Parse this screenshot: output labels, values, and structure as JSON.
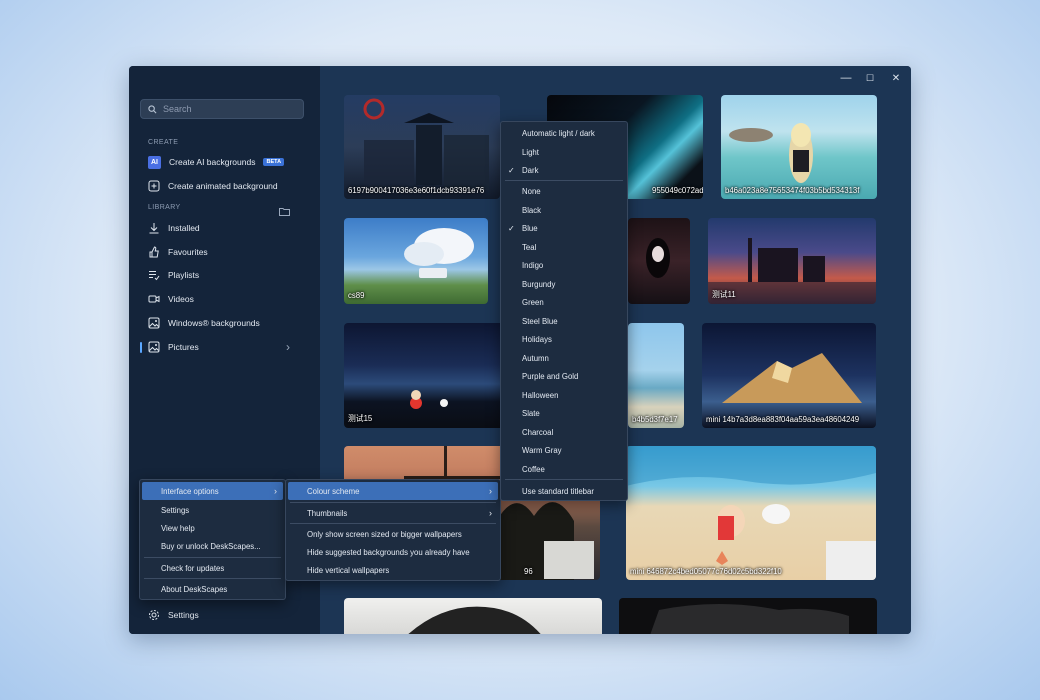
{
  "window": {
    "minimize": "—",
    "maximize": "☐",
    "close": "✕"
  },
  "search": {
    "placeholder": "Search"
  },
  "sidebar": {
    "create_label": "CREATE",
    "library_label": "LIBRARY",
    "ai_badge": "AI",
    "beta": "BETA",
    "items": [
      {
        "label": "Create AI backgrounds",
        "icon": "ai-icon"
      },
      {
        "label": "Create animated background",
        "icon": "add-icon"
      },
      {
        "label": "Installed",
        "icon": "download-icon"
      },
      {
        "label": "Favourites",
        "icon": "thumb-icon"
      },
      {
        "label": "Playlists",
        "icon": "playlist-icon"
      },
      {
        "label": "Videos",
        "icon": "video-icon"
      },
      {
        "label": "Windows® backgrounds",
        "icon": "image-icon"
      },
      {
        "label": "Pictures",
        "icon": "image-icon"
      }
    ],
    "settings": "Settings"
  },
  "tiles": [
    {
      "caption": "6197b900417036e3e60f1dcb93391e76"
    },
    {
      "caption": "955049c072ad9e6"
    },
    {
      "caption": "b46a023a8e75653474f03b5bd534313f"
    },
    {
      "caption": "cs89"
    },
    {
      "caption": ""
    },
    {
      "caption": "测试11"
    },
    {
      "caption": "测试15"
    },
    {
      "caption": "b4b5d3f7e17"
    },
    {
      "caption": "mini 14b7a3d8ea883f04aa59a3ea48604249"
    },
    {
      "caption": "96"
    },
    {
      "caption": "mini 646872c4bed05077c76d02c5bd322f10"
    }
  ],
  "main_menu": [
    {
      "label": "Interface options"
    },
    {
      "label": "Settings"
    },
    {
      "label": "View help"
    },
    {
      "label": "Buy or unlock DeskScapes..."
    },
    {
      "label": "Check for updates"
    },
    {
      "label": "About DeskScapes"
    }
  ],
  "interface_menu": [
    {
      "label": "Colour scheme"
    },
    {
      "label": "Thumbnails"
    },
    {
      "label": "Only show screen sized or bigger wallpapers"
    },
    {
      "label": "Hide suggested backgrounds you already have"
    },
    {
      "label": "Hide vertical wallpapers"
    }
  ],
  "colour_menu": [
    {
      "label": "Automatic light / dark",
      "checked": false
    },
    {
      "label": "Light",
      "checked": false
    },
    {
      "label": "Dark",
      "checked": true
    },
    {
      "label": "None",
      "checked": false
    },
    {
      "label": "Black",
      "checked": false
    },
    {
      "label": "Blue",
      "checked": true
    },
    {
      "label": "Teal",
      "checked": false
    },
    {
      "label": "Indigo",
      "checked": false
    },
    {
      "label": "Burgundy",
      "checked": false
    },
    {
      "label": "Green",
      "checked": false
    },
    {
      "label": "Steel Blue",
      "checked": false
    },
    {
      "label": "Holidays",
      "checked": false
    },
    {
      "label": "Autumn",
      "checked": false
    },
    {
      "label": "Purple and Gold",
      "checked": false
    },
    {
      "label": "Halloween",
      "checked": false
    },
    {
      "label": "Slate",
      "checked": false
    },
    {
      "label": "Charcoal",
      "checked": false
    },
    {
      "label": "Warm Gray",
      "checked": false
    },
    {
      "label": "Coffee",
      "checked": false
    },
    {
      "label": "Use standard titlebar",
      "checked": false
    }
  ],
  "check_glyph": "✓",
  "chevron": "›",
  "colors": {
    "accent": "#3c6fb8",
    "sidebar": "#14243a",
    "content": "#1c3554"
  }
}
